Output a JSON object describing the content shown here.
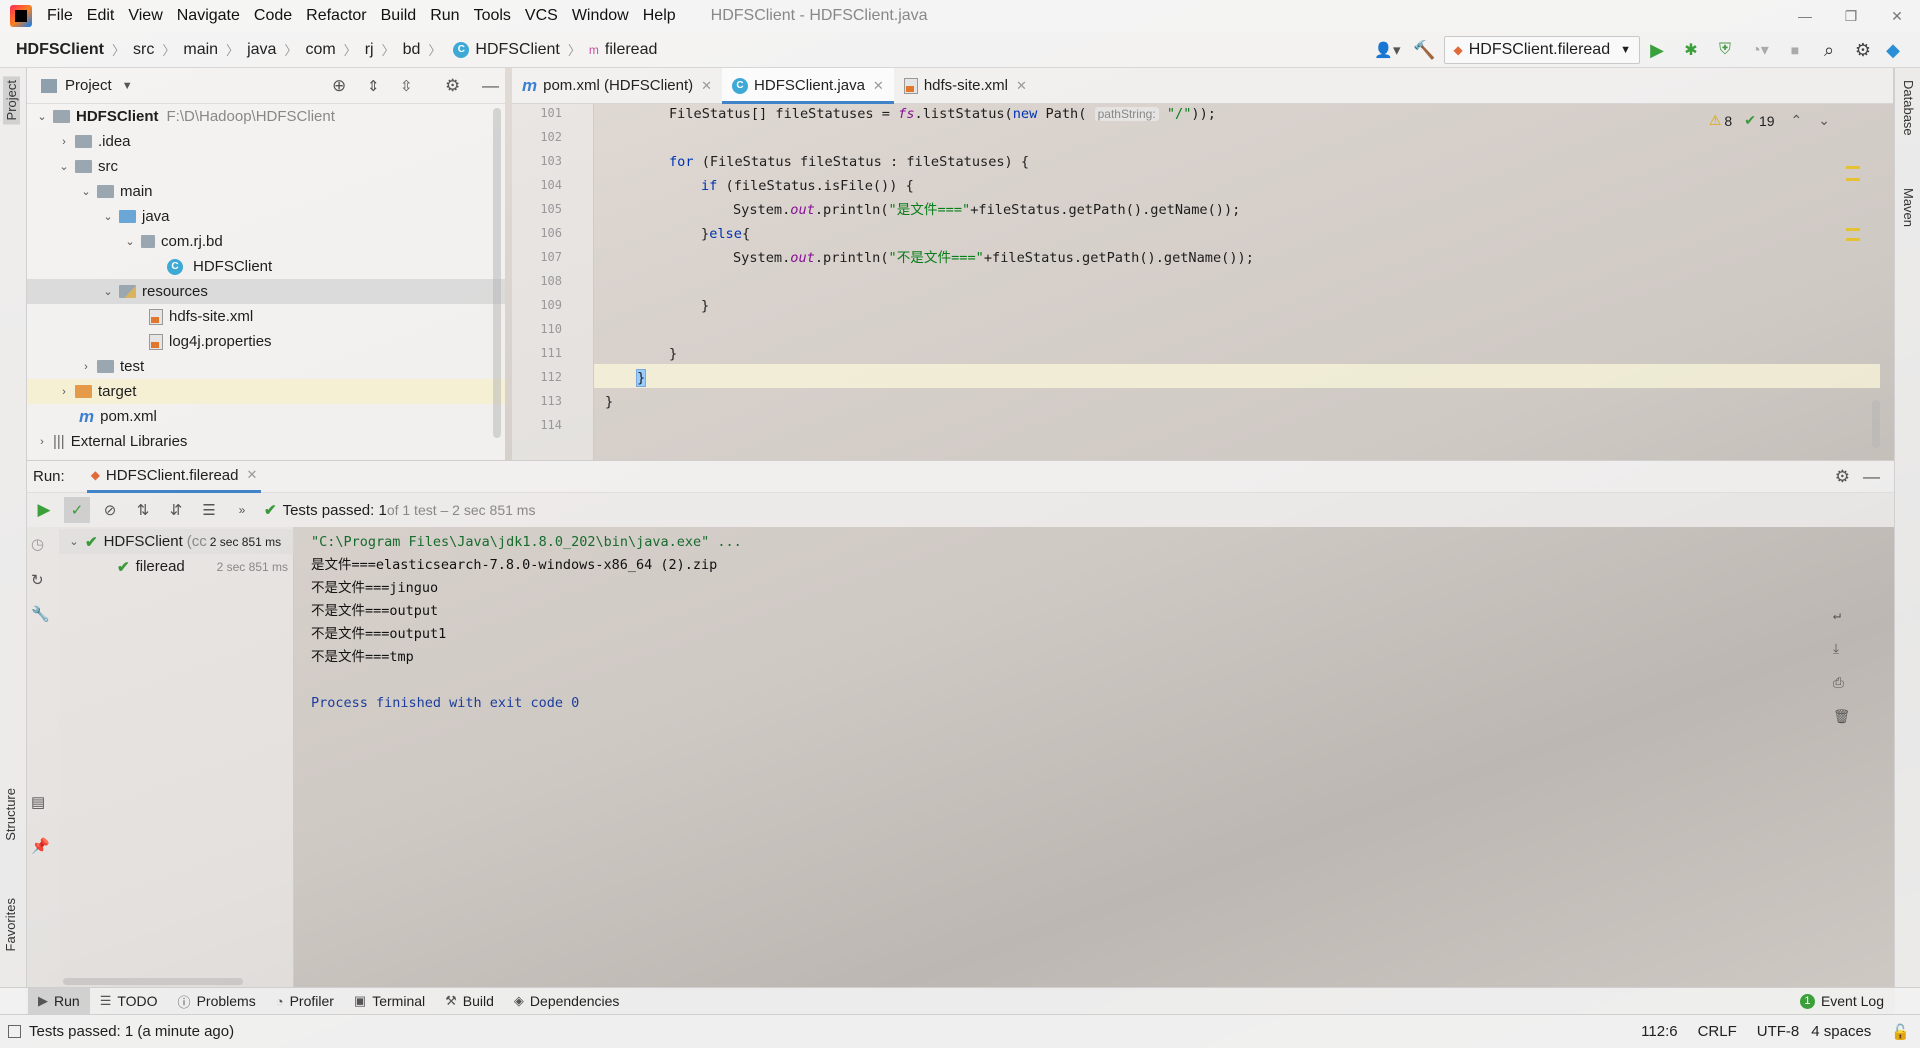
{
  "window": {
    "title": "HDFSClient - HDFSClient.java"
  },
  "menu": [
    "File",
    "Edit",
    "View",
    "Navigate",
    "Code",
    "Refactor",
    "Build",
    "Run",
    "Tools",
    "VCS",
    "Window",
    "Help"
  ],
  "breadcrumb": [
    "HDFSClient",
    "src",
    "main",
    "java",
    "com",
    "rj",
    "bd",
    "HDFSClient",
    "fileread"
  ],
  "toolbar": {
    "run_config": "HDFSClient.fileread"
  },
  "project_panel": {
    "title": "Project",
    "tree": [
      {
        "label": "HDFSClient",
        "path": "F:\\D\\Hadoop\\HDFSClient"
      },
      {
        "label": ".idea"
      },
      {
        "label": "src"
      },
      {
        "label": "main"
      },
      {
        "label": "java"
      },
      {
        "label": "com.rj.bd"
      },
      {
        "label": "HDFSClient"
      },
      {
        "label": "resources"
      },
      {
        "label": "hdfs-site.xml"
      },
      {
        "label": "log4j.properties"
      },
      {
        "label": "test"
      },
      {
        "label": "target"
      },
      {
        "label": "pom.xml"
      },
      {
        "label": "External Libraries"
      }
    ]
  },
  "editor": {
    "tabs": [
      {
        "label": "pom.xml (HDFSClient)"
      },
      {
        "label": "HDFSClient.java"
      },
      {
        "label": "hdfs-site.xml"
      }
    ],
    "line_numbers": [
      "101",
      "102",
      "103",
      "104",
      "105",
      "106",
      "107",
      "108",
      "109",
      "110",
      "111",
      "112",
      "113",
      "114"
    ],
    "warnings": "8",
    "checks": "19",
    "code": {
      "l101a": "FileStatus[] fileStatuses = ",
      "l101b": "fs",
      "l101c": ".listStatus(",
      "l101kw": "new",
      " l101d": "",
      "l101e": " Path( ",
      "l101hint": "pathString:",
      "l101str": "\"/\"",
      "l101f": "));",
      "l103kw": "for",
      "l103": " (FileStatus fileStatus : fileStatuses) {",
      "l104kw": "if",
      "l104": " (fileStatus.isFile()) {",
      "l105a": "System.",
      "l105fld": "out",
      "l105b": ".println(",
      "l105str": "\"是文件===\"",
      "l105c": "+fileStatus.getPath().getName());",
      "l106a": "}",
      "l106kw": "else",
      "l106b": "{",
      "l107a": "System.",
      "l107fld": "out",
      "l107b": ".println(",
      "l107str": "\"不是文件===\"",
      "l107c": "+fileStatus.getPath().getName());",
      "l109": "}",
      "l111": "}",
      "l112": "}",
      "l113": "}"
    }
  },
  "run_panel": {
    "label": "Run:",
    "tab": "HDFSClient.fileread",
    "status": "Tests passed: 1",
    "status_detail": " of 1 test – 2 sec 851 ms",
    "tests": [
      {
        "name": "HDFSClient",
        "extra": "(cc",
        "time": "2 sec 851 ms"
      },
      {
        "name": "fileread",
        "time": "2 sec 851 ms"
      }
    ],
    "console": [
      "\"C:\\Program Files\\Java\\jdk1.8.0_202\\bin\\java.exe\" ...",
      "是文件===elasticsearch-7.8.0-windows-x86_64 (2).zip",
      "不是文件===jinguo",
      "不是文件===output",
      "不是文件===output1",
      "不是文件===tmp",
      "",
      "Process finished with exit code 0"
    ]
  },
  "bottom_tabs": [
    {
      "label": "Run"
    },
    {
      "label": "TODO"
    },
    {
      "label": "Problems"
    },
    {
      "label": "Profiler"
    },
    {
      "label": "Terminal"
    },
    {
      "label": "Build"
    },
    {
      "label": "Dependencies"
    }
  ],
  "event_log": {
    "count": "1",
    "label": "Event Log"
  },
  "status_bar": {
    "message": "Tests passed: 1 (a minute ago)",
    "position": "112:6",
    "line_sep": "CRLF",
    "encoding": "UTF-8",
    "indent": "4 spaces"
  },
  "side_tabs": {
    "project": "Project",
    "structure": "Structure",
    "favorites": "Favorites",
    "database": "Database",
    "maven": "Maven"
  }
}
